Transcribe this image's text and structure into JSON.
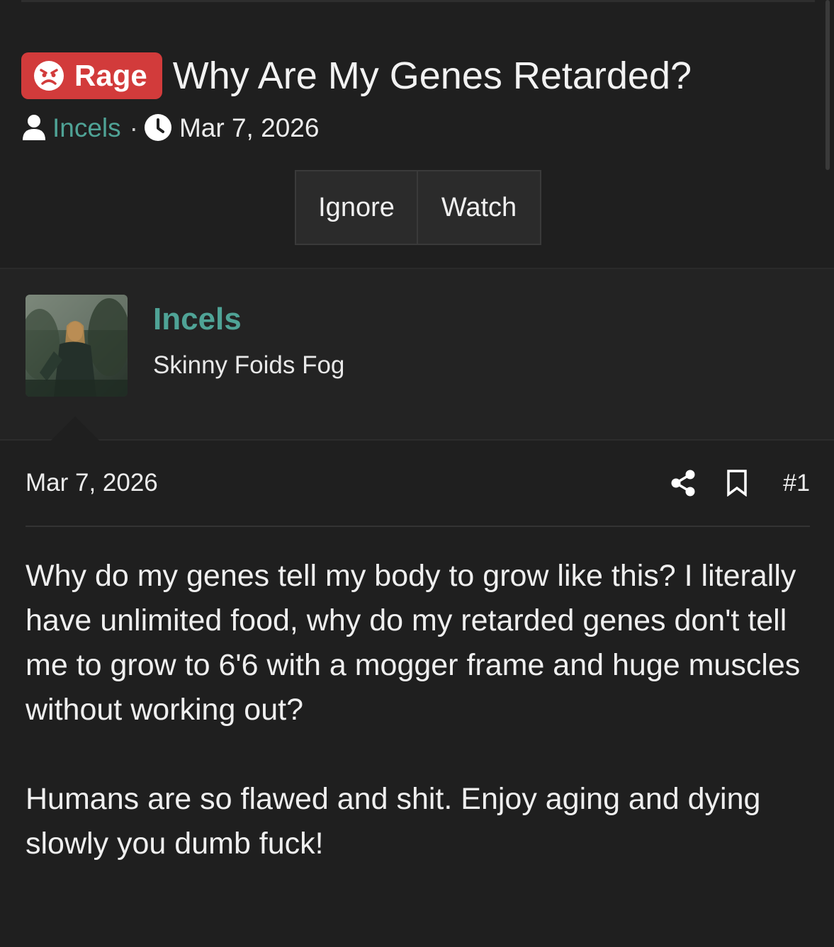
{
  "thread": {
    "prefix": "Rage",
    "title": "Why Are My Genes Retarded?",
    "author": "Incels",
    "separator": "·",
    "date": "Mar 7, 2026",
    "buttons": {
      "ignore": "Ignore",
      "watch": "Watch"
    }
  },
  "user": {
    "name": "Incels",
    "title": "Skinny Foids Fog"
  },
  "post": {
    "date": "Mar 7, 2026",
    "number": "#1",
    "paragraphs": [
      "Why do my genes tell my body to grow like this? I literally have unlimited food, why do my retarded genes don't tell me to grow to 6'6 with a mogger frame and huge muscles without working out?",
      "Humans are so flawed and shit. Enjoy aging and dying slowly you dumb fuck!"
    ]
  },
  "colors": {
    "background": "#1f1f1f",
    "user_block": "#232323",
    "badge": "#d23b3b",
    "link": "#4fa396",
    "button": "#2b2b2b"
  },
  "icons": {
    "prefix": "angry-face-icon",
    "author": "user-icon",
    "date": "clock-icon",
    "share": "share-icon",
    "bookmark": "bookmark-icon"
  }
}
